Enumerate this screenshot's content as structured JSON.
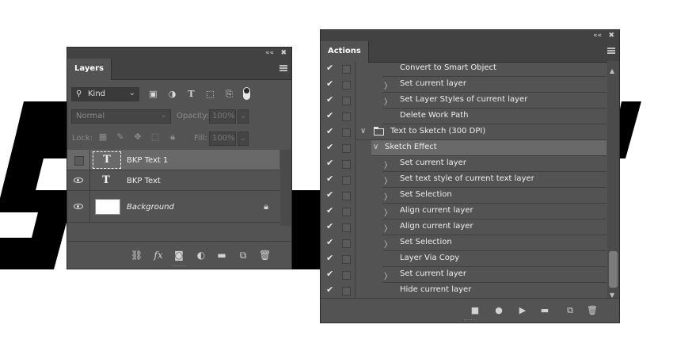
{
  "layers_panel": {
    "title_controls": {
      "collapse": "««",
      "close": "✖"
    },
    "tab_label": "Layers",
    "filter": {
      "kind_label": "Kind"
    },
    "blend_mode": "Normal",
    "opacity_label": "Opacity:",
    "opacity_value": "100%",
    "lock_label": "Lock:",
    "fill_label": "Fill:",
    "fill_value": "100%",
    "layers": [
      {
        "name": "BKP Text 1",
        "type": "text",
        "visible": false,
        "selected": true
      },
      {
        "name": "BKP Text",
        "type": "text",
        "visible": true,
        "selected": false
      },
      {
        "name": "Background",
        "type": "image",
        "visible": true,
        "locked": true,
        "selected": false
      }
    ],
    "bottom_icons": [
      "link-icon",
      "fx-icon",
      "mask-icon",
      "adjustment-icon",
      "folder-icon",
      "new-layer-icon",
      "trash-icon"
    ],
    "fx_text": "fx"
  },
  "actions_panel": {
    "title_controls": {
      "collapse": "««",
      "close": "✖"
    },
    "tab_label": "Actions",
    "rows": [
      {
        "label": "Convert to Smart Object",
        "expander": false,
        "level": 2
      },
      {
        "label": "Set current layer",
        "expander": true,
        "level": 2
      },
      {
        "label": "Set Layer Styles of current layer",
        "expander": true,
        "level": 2
      },
      {
        "label": "Delete Work Path",
        "expander": false,
        "level": 2
      },
      {
        "label": "Text to Sketch (300 DPI)",
        "expander": true,
        "expanded": true,
        "level": 0,
        "folder": true
      },
      {
        "label": "Sketch Effect",
        "expander": true,
        "expanded": true,
        "level": 1,
        "highlighted": true
      },
      {
        "label": "Set current layer",
        "expander": true,
        "level": 2
      },
      {
        "label": "Set text style of current text layer",
        "expander": true,
        "level": 2
      },
      {
        "label": "Set Selection",
        "expander": true,
        "level": 2
      },
      {
        "label": "Align current layer",
        "expander": true,
        "level": 2
      },
      {
        "label": "Align current layer",
        "expander": true,
        "level": 2
      },
      {
        "label": "Set Selection",
        "expander": true,
        "level": 2
      },
      {
        "label": "Layer Via Copy",
        "expander": false,
        "level": 2
      },
      {
        "label": "Set current layer",
        "expander": true,
        "level": 2
      },
      {
        "label": "Hide current layer",
        "expander": false,
        "level": 2
      }
    ],
    "bottom_icons": [
      "stop-icon",
      "record-icon",
      "play-icon",
      "folder-icon",
      "new-action-icon",
      "trash-icon"
    ]
  }
}
